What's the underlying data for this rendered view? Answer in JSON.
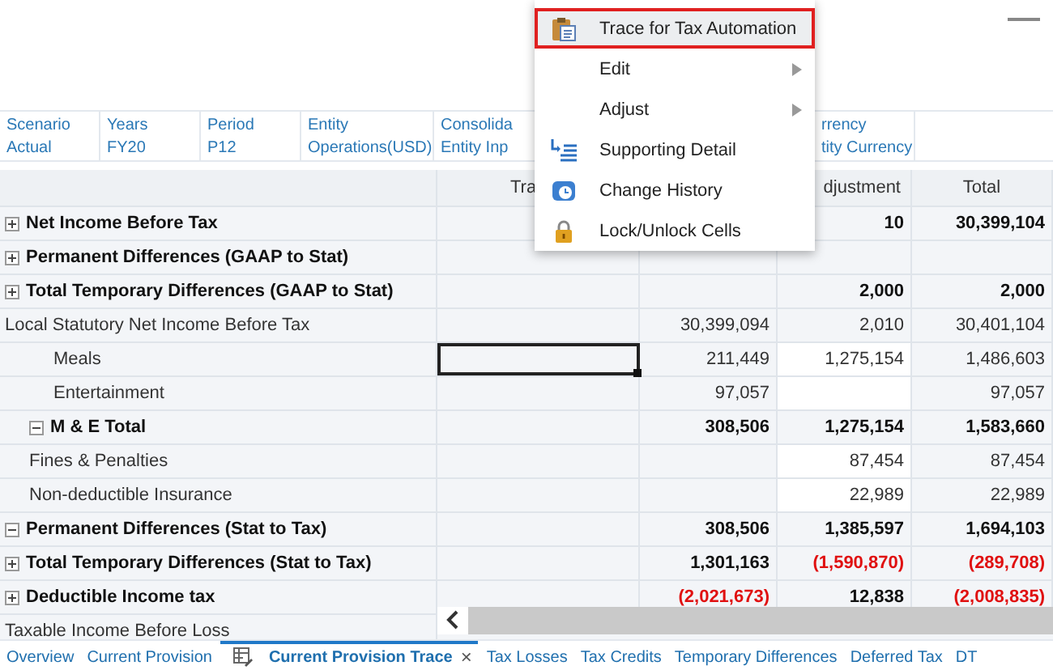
{
  "pov": [
    {
      "label": "Scenario",
      "value": "Actual"
    },
    {
      "label": "Years",
      "value": "FY20"
    },
    {
      "label": "Period",
      "value": "P12"
    },
    {
      "label": "Entity",
      "value": "Operations(USD)"
    },
    {
      "label": "Consolida",
      "value": "Entity Inp"
    },
    {
      "label": "rrency",
      "value": "tity Currency"
    }
  ],
  "grid": {
    "columns": [
      "Tra",
      "",
      "djustment",
      "Total"
    ],
    "rows": [
      {
        "label": "Net Income Before Tax",
        "kind": "parent",
        "expanded": false,
        "cells": [
          {},
          {},
          {
            "text": "10",
            "negative": false,
            "editable": false,
            "selected": false
          },
          {
            "text": "30,399,104",
            "negative": false,
            "editable": false,
            "selected": false
          }
        ]
      },
      {
        "label": "Permanent Differences (GAAP to Stat)",
        "kind": "parent",
        "expanded": false,
        "cells": [
          {},
          {},
          {},
          {}
        ]
      },
      {
        "label": "Total Temporary Differences (GAAP to Stat)",
        "kind": "parent",
        "expanded": false,
        "cells": [
          {},
          {},
          {
            "text": "2,000",
            "negative": false,
            "editable": false,
            "selected": false
          },
          {
            "text": "2,000",
            "negative": false,
            "editable": false,
            "selected": false
          }
        ]
      },
      {
        "label": "Local Statutory Net Income Before Tax",
        "kind": "leaf",
        "cells": [
          {},
          {
            "text": "30,399,094",
            "negative": false,
            "editable": false,
            "selected": false
          },
          {
            "text": "2,010",
            "negative": false,
            "editable": false,
            "selected": false
          },
          {
            "text": "30,401,104",
            "negative": false,
            "editable": false,
            "selected": false
          }
        ]
      },
      {
        "label": "Permanent Differences (Stat to Tax)",
        "kind": "parent",
        "expanded": true,
        "cells": [
          {},
          {
            "text": "308,506",
            "negative": false,
            "editable": false,
            "selected": false
          },
          {
            "text": "1,385,597",
            "negative": false,
            "editable": false,
            "selected": false
          },
          {
            "text": "1,694,103",
            "negative": false,
            "editable": false,
            "selected": false
          }
        ],
        "children": [
          {
            "label": "M & E Total",
            "kind": "parent",
            "expanded": true,
            "cells": [
              {},
              {
                "text": "308,506",
                "negative": false,
                "editable": false,
                "selected": false
              },
              {
                "text": "1,275,154",
                "negative": false,
                "editable": false,
                "selected": false
              },
              {
                "text": "1,583,660",
                "negative": false,
                "editable": false,
                "selected": false
              }
            ],
            "children": [
              {
                "label": "Meals",
                "kind": "leaf",
                "cells": [
                  {
                    "editable": false,
                    "selected": true
                  },
                  {
                    "text": "211,449",
                    "negative": false,
                    "editable": false,
                    "selected": false
                  },
                  {
                    "text": "1,275,154",
                    "negative": false,
                    "editable": true,
                    "selected": false
                  },
                  {
                    "text": "1,486,603",
                    "negative": false,
                    "editable": false,
                    "selected": false
                  }
                ]
              },
              {
                "label": "Entertainment",
                "kind": "leaf",
                "cells": [
                  {},
                  {
                    "text": "97,057",
                    "negative": false,
                    "editable": false,
                    "selected": false
                  },
                  {
                    "editable": true,
                    "selected": false
                  },
                  {
                    "text": "97,057",
                    "negative": false,
                    "editable": false,
                    "selected": false
                  }
                ]
              }
            ]
          },
          {
            "label": "Fines & Penalties",
            "kind": "leaf",
            "cells": [
              {},
              {},
              {
                "text": "87,454",
                "negative": false,
                "editable": true,
                "selected": false
              },
              {
                "text": "87,454",
                "negative": false,
                "editable": false,
                "selected": false
              }
            ]
          },
          {
            "label": "Non-deductible Insurance",
            "kind": "leaf",
            "cells": [
              {},
              {},
              {
                "text": "22,989",
                "negative": false,
                "editable": true,
                "selected": false
              },
              {
                "text": "22,989",
                "negative": false,
                "editable": false,
                "selected": false
              }
            ]
          }
        ]
      },
      {
        "label": "Total Temporary Differences (Stat to Tax)",
        "kind": "parent",
        "expanded": false,
        "cells": [
          {},
          {
            "text": "1,301,163",
            "negative": false,
            "editable": false,
            "selected": false
          },
          {
            "text": "(1,590,870)",
            "negative": true,
            "editable": false,
            "selected": false
          },
          {
            "text": "(289,708)",
            "negative": true,
            "editable": false,
            "selected": false
          }
        ]
      },
      {
        "label": "Deductible Income tax",
        "kind": "parent",
        "expanded": false,
        "cells": [
          {},
          {
            "text": "(2,021,673)",
            "negative": true,
            "editable": false,
            "selected": false
          },
          {
            "text": "12,838",
            "negative": false,
            "editable": false,
            "selected": false
          },
          {
            "text": "(2,008,835)",
            "negative": true,
            "editable": false,
            "selected": false
          }
        ]
      },
      {
        "label": "Taxable Income Before Loss",
        "kind": "leaf"
      }
    ]
  },
  "menu": [
    {
      "label": "Trace for Tax Automation",
      "selected": true,
      "submenu": false
    },
    {
      "label": "Edit",
      "selected": false,
      "submenu": true
    },
    {
      "label": "Adjust",
      "selected": false,
      "submenu": true
    },
    {
      "label": "Supporting Detail",
      "selected": false,
      "submenu": false
    },
    {
      "label": "Change History",
      "selected": false,
      "submenu": false
    },
    {
      "label": "Lock/Unlock Cells",
      "selected": false,
      "submenu": false
    }
  ],
  "tabs": [
    {
      "label": "Overview",
      "selected": false
    },
    {
      "label": "Current Provision",
      "selected": false
    },
    {
      "label": "Current Provision Trace",
      "selected": true,
      "close": "×"
    },
    {
      "label": "Tax Losses",
      "selected": false
    },
    {
      "label": "Tax Credits",
      "selected": false
    },
    {
      "label": "Temporary Differences",
      "selected": false
    },
    {
      "label": "Deferred Tax",
      "selected": false
    },
    {
      "label": "DT",
      "selected": false
    }
  ]
}
